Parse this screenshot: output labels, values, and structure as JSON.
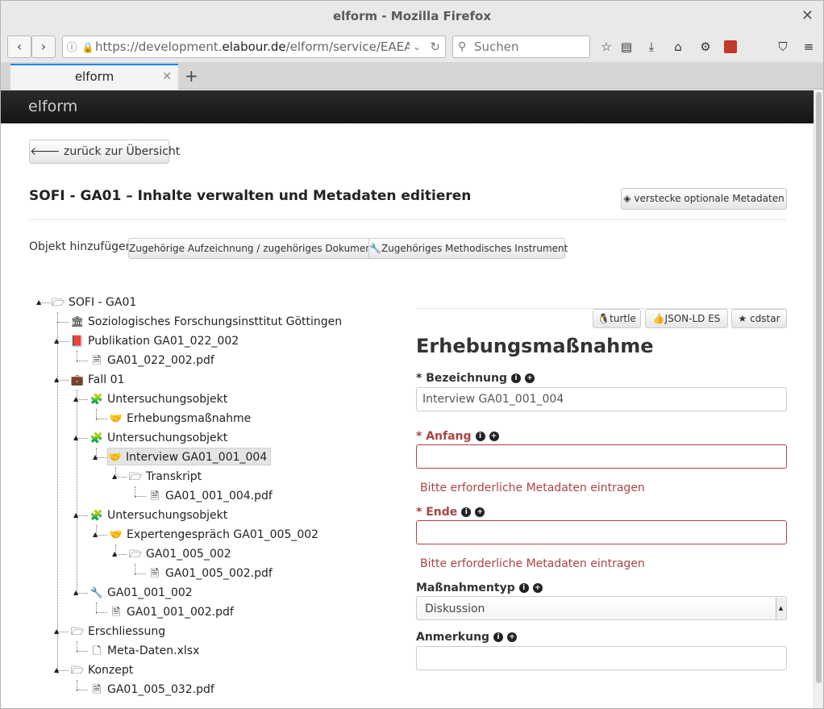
{
  "browser": {
    "window_title": "elform - Mozilla Firefox",
    "url_prefix": "https://development.",
    "url_host": "elabour.de",
    "url_path": "/elform/service/EAEA",
    "search_placeholder": "Suchen",
    "tab_label": "elform"
  },
  "app": {
    "brand": "elform"
  },
  "page": {
    "back_label": "zurück zur Übersicht",
    "title": "SOFI - GA01 – Inhalte verwalten und Metadaten editieren",
    "hide_optional_label": "verstecke optionale Metadaten",
    "add_object_label": "Objekt hinzufügen:",
    "add_recording_label": "Zugehörige Aufzeichnung / zugehöriges Dokument",
    "add_instrument_label": "Zugehöriges Methodisches Instrument"
  },
  "tree": {
    "root": "SOFI - GA01",
    "inst": "Soziologisches Forschungsinsttitut Göttingen",
    "pub": "Publikation GA01_022_002",
    "pub_pdf": "GA01_022_002.pdf",
    "fall": "Fall 01",
    "uo1": "Untersuchungsobjekt",
    "erheb": "Erhebungsmaßnahme",
    "uo2": "Untersuchungsobjekt",
    "interview": "Interview GA01_001_004",
    "transkript": "Transkript",
    "t_pdf": "GA01_001_004.pdf",
    "uo3": "Untersuchungsobjekt",
    "experten": "Expertengespräch GA01_005_002",
    "g005": "GA01_005_002",
    "g005_pdf": "GA01_005_002.pdf",
    "g001": "GA01_001_002",
    "g001_pdf": "GA01_001_002.pdf",
    "erschl": "Erschliessung",
    "meta": "Meta-Daten.xlsx",
    "konzept": "Konzept",
    "k_pdf": "GA01_005_032.pdf"
  },
  "form": {
    "turtle_label": "turtle",
    "jsonld_label": "JSON-LD ES",
    "cdstar_label": "cdstar",
    "heading": "Erhebungsmaßnahme",
    "bezeichnung_label": "* Bezeichnung",
    "bezeichnung_value": "Interview GA01_001_004",
    "anfang_label": "* Anfang",
    "anfang_error": "Bitte erforderliche Metadaten eintragen",
    "ende_label": "* Ende",
    "ende_error": "Bitte erforderliche Metadaten eintragen",
    "typ_label": "Maßnahmentyp",
    "typ_value": "Diskussion",
    "anmerkung_label": "Anmerkung"
  }
}
